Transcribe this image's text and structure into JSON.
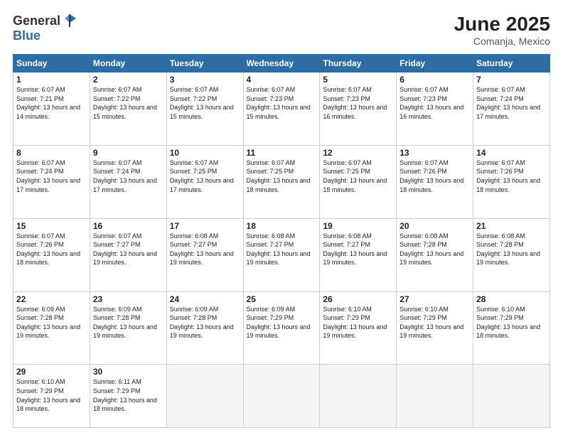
{
  "header": {
    "logo_general": "General",
    "logo_blue": "Blue",
    "month_year": "June 2025",
    "location": "Comanja, Mexico"
  },
  "days_of_week": [
    "Sunday",
    "Monday",
    "Tuesday",
    "Wednesday",
    "Thursday",
    "Friday",
    "Saturday"
  ],
  "weeks": [
    [
      {
        "day": "1",
        "sunrise": "6:07 AM",
        "sunset": "7:21 PM",
        "daylight": "13 hours and 14 minutes."
      },
      {
        "day": "2",
        "sunrise": "6:07 AM",
        "sunset": "7:22 PM",
        "daylight": "13 hours and 15 minutes."
      },
      {
        "day": "3",
        "sunrise": "6:07 AM",
        "sunset": "7:22 PM",
        "daylight": "13 hours and 15 minutes."
      },
      {
        "day": "4",
        "sunrise": "6:07 AM",
        "sunset": "7:23 PM",
        "daylight": "13 hours and 15 minutes."
      },
      {
        "day": "5",
        "sunrise": "6:07 AM",
        "sunset": "7:23 PM",
        "daylight": "13 hours and 16 minutes."
      },
      {
        "day": "6",
        "sunrise": "6:07 AM",
        "sunset": "7:23 PM",
        "daylight": "13 hours and 16 minutes."
      },
      {
        "day": "7",
        "sunrise": "6:07 AM",
        "sunset": "7:24 PM",
        "daylight": "13 hours and 17 minutes."
      }
    ],
    [
      {
        "day": "8",
        "sunrise": "6:07 AM",
        "sunset": "7:24 PM",
        "daylight": "13 hours and 17 minutes."
      },
      {
        "day": "9",
        "sunrise": "6:07 AM",
        "sunset": "7:24 PM",
        "daylight": "13 hours and 17 minutes."
      },
      {
        "day": "10",
        "sunrise": "6:07 AM",
        "sunset": "7:25 PM",
        "daylight": "13 hours and 17 minutes."
      },
      {
        "day": "11",
        "sunrise": "6:07 AM",
        "sunset": "7:25 PM",
        "daylight": "13 hours and 18 minutes."
      },
      {
        "day": "12",
        "sunrise": "6:07 AM",
        "sunset": "7:25 PM",
        "daylight": "13 hours and 18 minutes."
      },
      {
        "day": "13",
        "sunrise": "6:07 AM",
        "sunset": "7:26 PM",
        "daylight": "13 hours and 18 minutes."
      },
      {
        "day": "14",
        "sunrise": "6:07 AM",
        "sunset": "7:26 PM",
        "daylight": "13 hours and 18 minutes."
      }
    ],
    [
      {
        "day": "15",
        "sunrise": "6:07 AM",
        "sunset": "7:26 PM",
        "daylight": "13 hours and 18 minutes."
      },
      {
        "day": "16",
        "sunrise": "6:07 AM",
        "sunset": "7:27 PM",
        "daylight": "13 hours and 19 minutes."
      },
      {
        "day": "17",
        "sunrise": "6:08 AM",
        "sunset": "7:27 PM",
        "daylight": "13 hours and 19 minutes."
      },
      {
        "day": "18",
        "sunrise": "6:08 AM",
        "sunset": "7:27 PM",
        "daylight": "13 hours and 19 minutes."
      },
      {
        "day": "19",
        "sunrise": "6:08 AM",
        "sunset": "7:27 PM",
        "daylight": "13 hours and 19 minutes."
      },
      {
        "day": "20",
        "sunrise": "6:08 AM",
        "sunset": "7:28 PM",
        "daylight": "13 hours and 19 minutes."
      },
      {
        "day": "21",
        "sunrise": "6:08 AM",
        "sunset": "7:28 PM",
        "daylight": "13 hours and 19 minutes."
      }
    ],
    [
      {
        "day": "22",
        "sunrise": "6:09 AM",
        "sunset": "7:28 PM",
        "daylight": "13 hours and 19 minutes."
      },
      {
        "day": "23",
        "sunrise": "6:09 AM",
        "sunset": "7:28 PM",
        "daylight": "13 hours and 19 minutes."
      },
      {
        "day": "24",
        "sunrise": "6:09 AM",
        "sunset": "7:28 PM",
        "daylight": "13 hours and 19 minutes."
      },
      {
        "day": "25",
        "sunrise": "6:09 AM",
        "sunset": "7:29 PM",
        "daylight": "13 hours and 19 minutes."
      },
      {
        "day": "26",
        "sunrise": "6:10 AM",
        "sunset": "7:29 PM",
        "daylight": "13 hours and 19 minutes."
      },
      {
        "day": "27",
        "sunrise": "6:10 AM",
        "sunset": "7:29 PM",
        "daylight": "13 hours and 19 minutes."
      },
      {
        "day": "28",
        "sunrise": "6:10 AM",
        "sunset": "7:29 PM",
        "daylight": "13 hours and 18 minutes."
      }
    ],
    [
      {
        "day": "29",
        "sunrise": "6:10 AM",
        "sunset": "7:29 PM",
        "daylight": "13 hours and 18 minutes."
      },
      {
        "day": "30",
        "sunrise": "6:11 AM",
        "sunset": "7:29 PM",
        "daylight": "13 hours and 18 minutes."
      },
      null,
      null,
      null,
      null,
      null
    ]
  ]
}
